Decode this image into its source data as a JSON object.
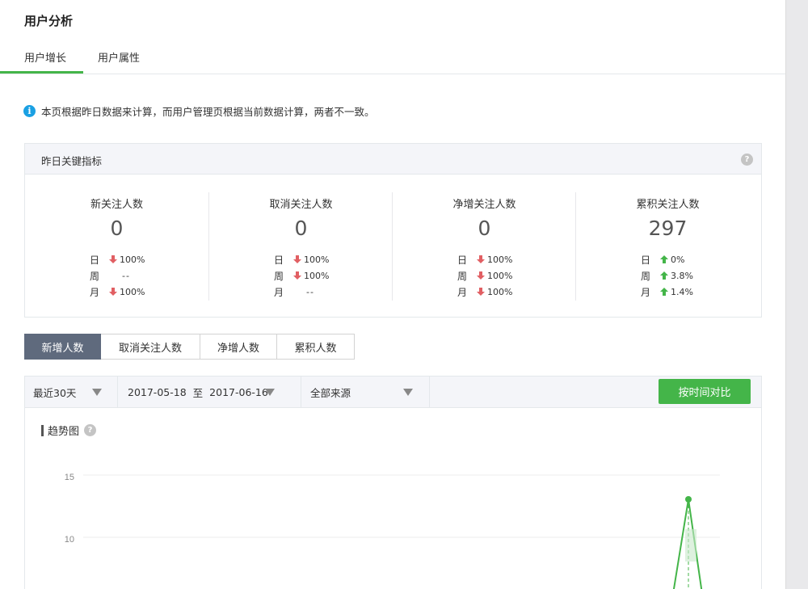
{
  "page": {
    "title": "用户分析"
  },
  "tabs": [
    {
      "label": "用户增长"
    },
    {
      "label": "用户属性"
    }
  ],
  "notice": {
    "icon": "info-icon",
    "text": "本页根据昨日数据来计算，而用户管理页根据当前数据计算，两者不一致。"
  },
  "metrics": {
    "header": "昨日关键指标",
    "items": [
      {
        "name": "新关注人数",
        "value": "0",
        "rows": [
          {
            "period": "日",
            "dir": "down",
            "text": "100%"
          },
          {
            "period": "周",
            "dir": "none",
            "text": "--"
          },
          {
            "period": "月",
            "dir": "down",
            "text": "100%"
          }
        ]
      },
      {
        "name": "取消关注人数",
        "value": "0",
        "rows": [
          {
            "period": "日",
            "dir": "down",
            "text": "100%"
          },
          {
            "period": "周",
            "dir": "down",
            "text": "100%"
          },
          {
            "period": "月",
            "dir": "none",
            "text": "--"
          }
        ]
      },
      {
        "name": "净增关注人数",
        "value": "0",
        "rows": [
          {
            "period": "日",
            "dir": "down",
            "text": "100%"
          },
          {
            "period": "周",
            "dir": "down",
            "text": "100%"
          },
          {
            "period": "月",
            "dir": "down",
            "text": "100%"
          }
        ]
      },
      {
        "name": "累积关注人数",
        "value": "297",
        "rows": [
          {
            "period": "日",
            "dir": "up",
            "text": "0%"
          },
          {
            "period": "周",
            "dir": "up",
            "text": "3.8%"
          },
          {
            "period": "月",
            "dir": "up",
            "text": "1.4%"
          }
        ]
      }
    ]
  },
  "segments": [
    {
      "label": "新增人数",
      "active": true
    },
    {
      "label": "取消关注人数",
      "active": false
    },
    {
      "label": "净增人数",
      "active": false
    },
    {
      "label": "累积人数",
      "active": false
    }
  ],
  "filters": {
    "range": "最近30天",
    "date_from": "2017-05-18",
    "date_sep": "至",
    "date_to": "2017-06-16",
    "source": "全部来源",
    "compare_button": "按时间对比"
  },
  "chart": {
    "title": "趋势图"
  },
  "colors": {
    "accent": "#44b549",
    "down": "#e15f63",
    "up": "#44b549",
    "active_segment": "#5f6a7d"
  },
  "chart_data": {
    "type": "line",
    "title": "",
    "y_ticks": [
      10,
      15
    ],
    "series": [
      {
        "values_visible": [
          0,
          13,
          0
        ]
      }
    ]
  }
}
